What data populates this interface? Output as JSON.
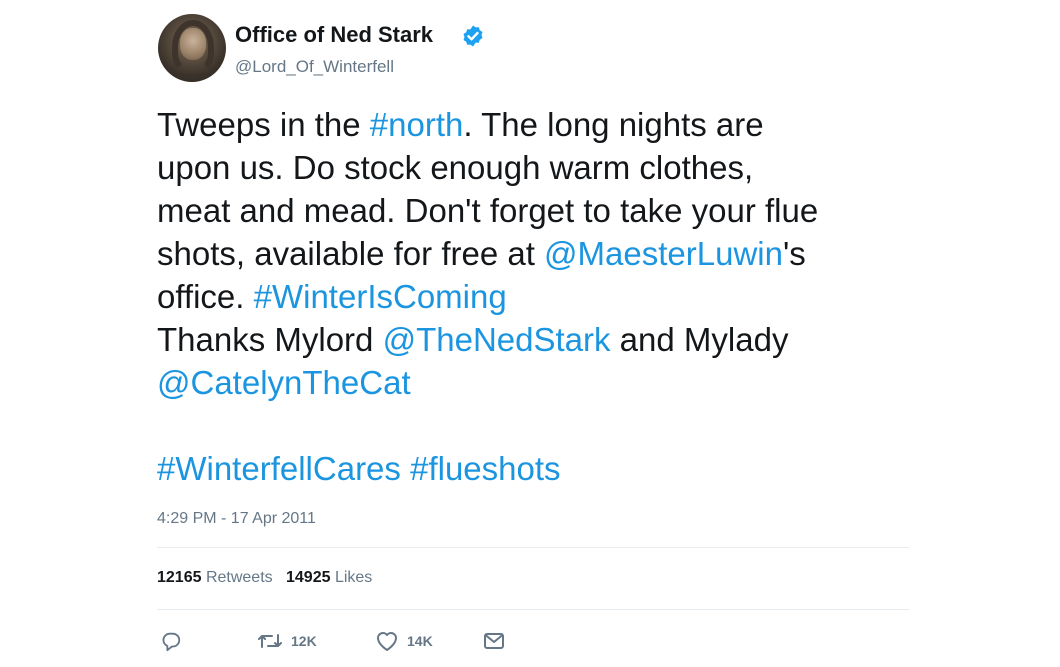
{
  "user": {
    "display_name": "Office of Ned Stark",
    "handle": "@Lord_Of_Winterfell",
    "verified": true
  },
  "tweet": {
    "lines": [
      [
        {
          "t": "Tweeps in the "
        },
        {
          "t": "#north",
          "link": true
        },
        {
          "t": ". The long nights are"
        }
      ],
      [
        {
          "t": "upon us. Do stock enough warm clothes,"
        }
      ],
      [
        {
          "t": "meat and mead. Don't forget to take your flue"
        }
      ],
      [
        {
          "t": "shots, available for free at "
        },
        {
          "t": "@MaesterLuwin",
          "link": true
        },
        {
          "t": "'s"
        }
      ],
      [
        {
          "t": "office. "
        },
        {
          "t": "#WinterIsComing",
          "link": true
        }
      ],
      [
        {
          "t": "Thanks Mylord "
        },
        {
          "t": "@TheNedStark",
          "link": true
        },
        {
          "t": " and Mylady"
        }
      ],
      [
        {
          "t": "@CatelynTheCat",
          "link": true
        }
      ],
      [],
      [
        {
          "t": "#WinterfellCares",
          "link": true
        },
        {
          "t": " "
        },
        {
          "t": "#flueshots",
          "link": true
        }
      ]
    ],
    "timestamp": "4:29 PM - 17 Apr 2011"
  },
  "stats": {
    "retweets_count": "12165",
    "retweets_label": "Retweets",
    "likes_count": "14925",
    "likes_label": "Likes"
  },
  "actions": {
    "reply_icon": "reply-icon",
    "retweet_icon": "retweet-icon",
    "retweet_count": "12K",
    "like_icon": "heart-icon",
    "like_count": "14K",
    "message_icon": "envelope-icon"
  },
  "colors": {
    "link": "#1b95e0",
    "text": "#14171a",
    "muted": "#657786",
    "divider": "#e6ecf0",
    "verified": "#1da1f2"
  }
}
